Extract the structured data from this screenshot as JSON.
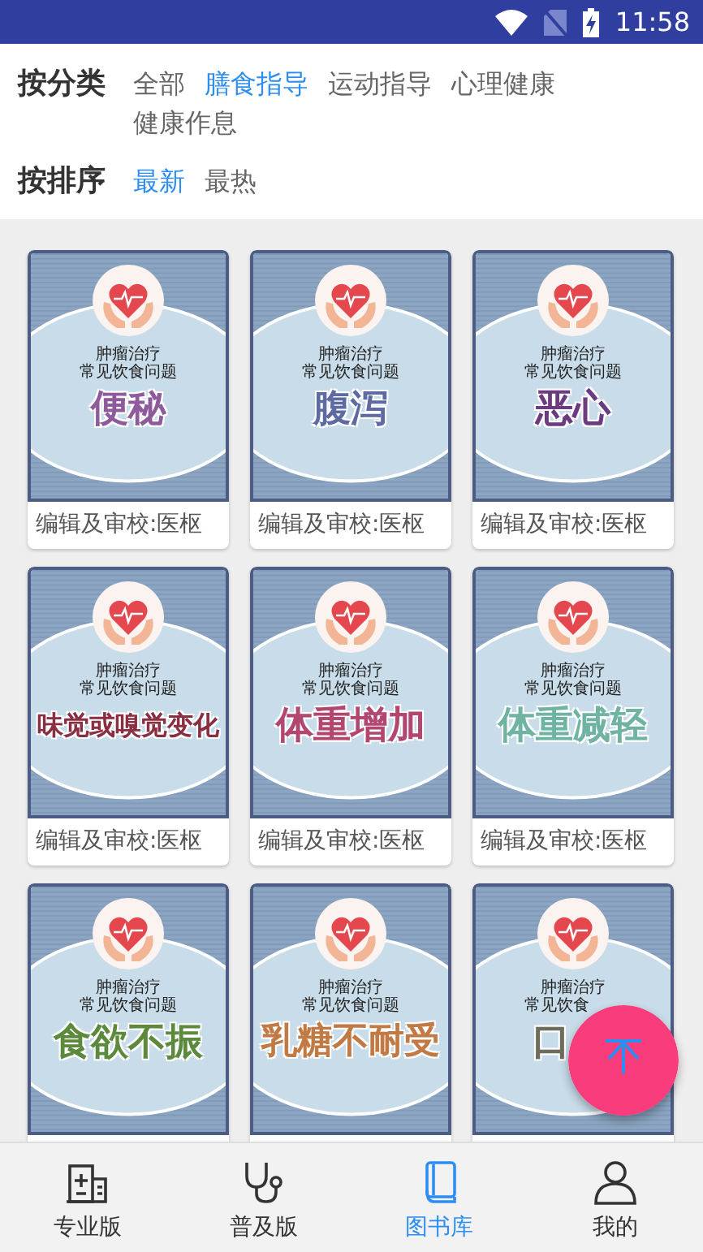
{
  "status_bar": {
    "time": "11:58"
  },
  "filters": [
    {
      "label": "按分类",
      "options": [
        {
          "label": "全部",
          "selected": false
        },
        {
          "label": "膳食指导",
          "selected": true
        },
        {
          "label": "运动指导",
          "selected": false
        },
        {
          "label": "心理健康",
          "selected": false
        },
        {
          "label": "健康作息",
          "selected": false
        }
      ]
    },
    {
      "label": "按排序",
      "options": [
        {
          "label": "最新",
          "selected": true
        },
        {
          "label": "最热",
          "selected": false
        }
      ]
    }
  ],
  "books": [
    {
      "series": "肿瘤治疗",
      "subtitle": "常见饮食问题",
      "title": "便秘",
      "color": "#8e5a9c",
      "covered": false,
      "caption": "编辑及审校:医枢"
    },
    {
      "series": "肿瘤治疗",
      "subtitle": "常见饮食问题",
      "title": "腹泻",
      "color": "#5e6aa2",
      "covered": false,
      "caption": "编辑及审校:医枢"
    },
    {
      "series": "肿瘤治疗",
      "subtitle": "常见饮食问题",
      "title": "恶心",
      "color": "#6b3a80",
      "covered": false,
      "caption": "编辑及审校:医枢"
    },
    {
      "series": "肿瘤治疗",
      "subtitle": "常见饮食问题",
      "title": "味觉或嗅觉变化",
      "color": "#8a2f42",
      "covered": false,
      "caption": "编辑及审校:医枢"
    },
    {
      "series": "肿瘤治疗",
      "subtitle": "常见饮食问题",
      "title": "体重增加",
      "color": "#b3466f",
      "covered": false,
      "caption": "编辑及审校:医枢"
    },
    {
      "series": "肿瘤治疗",
      "subtitle": "常见饮食问题",
      "title": "体重减轻",
      "color": "#6fb3a2",
      "covered": false,
      "caption": "编辑及审校:医枢"
    },
    {
      "series": "肿瘤治疗",
      "subtitle": "常见饮食问题",
      "title": "食欲不振",
      "color": "#5c8a3c",
      "covered": false
    },
    {
      "series": "肿瘤治疗",
      "subtitle": "常见饮食问题",
      "title": "乳糖不耐受",
      "color": "#c27a45",
      "covered": false
    },
    {
      "series": "肿瘤治疗",
      "subtitle": "常见饮食",
      "title": "口",
      "color": "#6e6c5c",
      "covered": true
    }
  ],
  "nav": [
    {
      "label": "专业版",
      "kind": "hospital",
      "selected": false
    },
    {
      "label": "普及版",
      "kind": "stethoscope",
      "selected": false
    },
    {
      "label": "图书库",
      "kind": "book",
      "selected": true
    },
    {
      "label": "我的",
      "kind": "person",
      "selected": false
    }
  ]
}
